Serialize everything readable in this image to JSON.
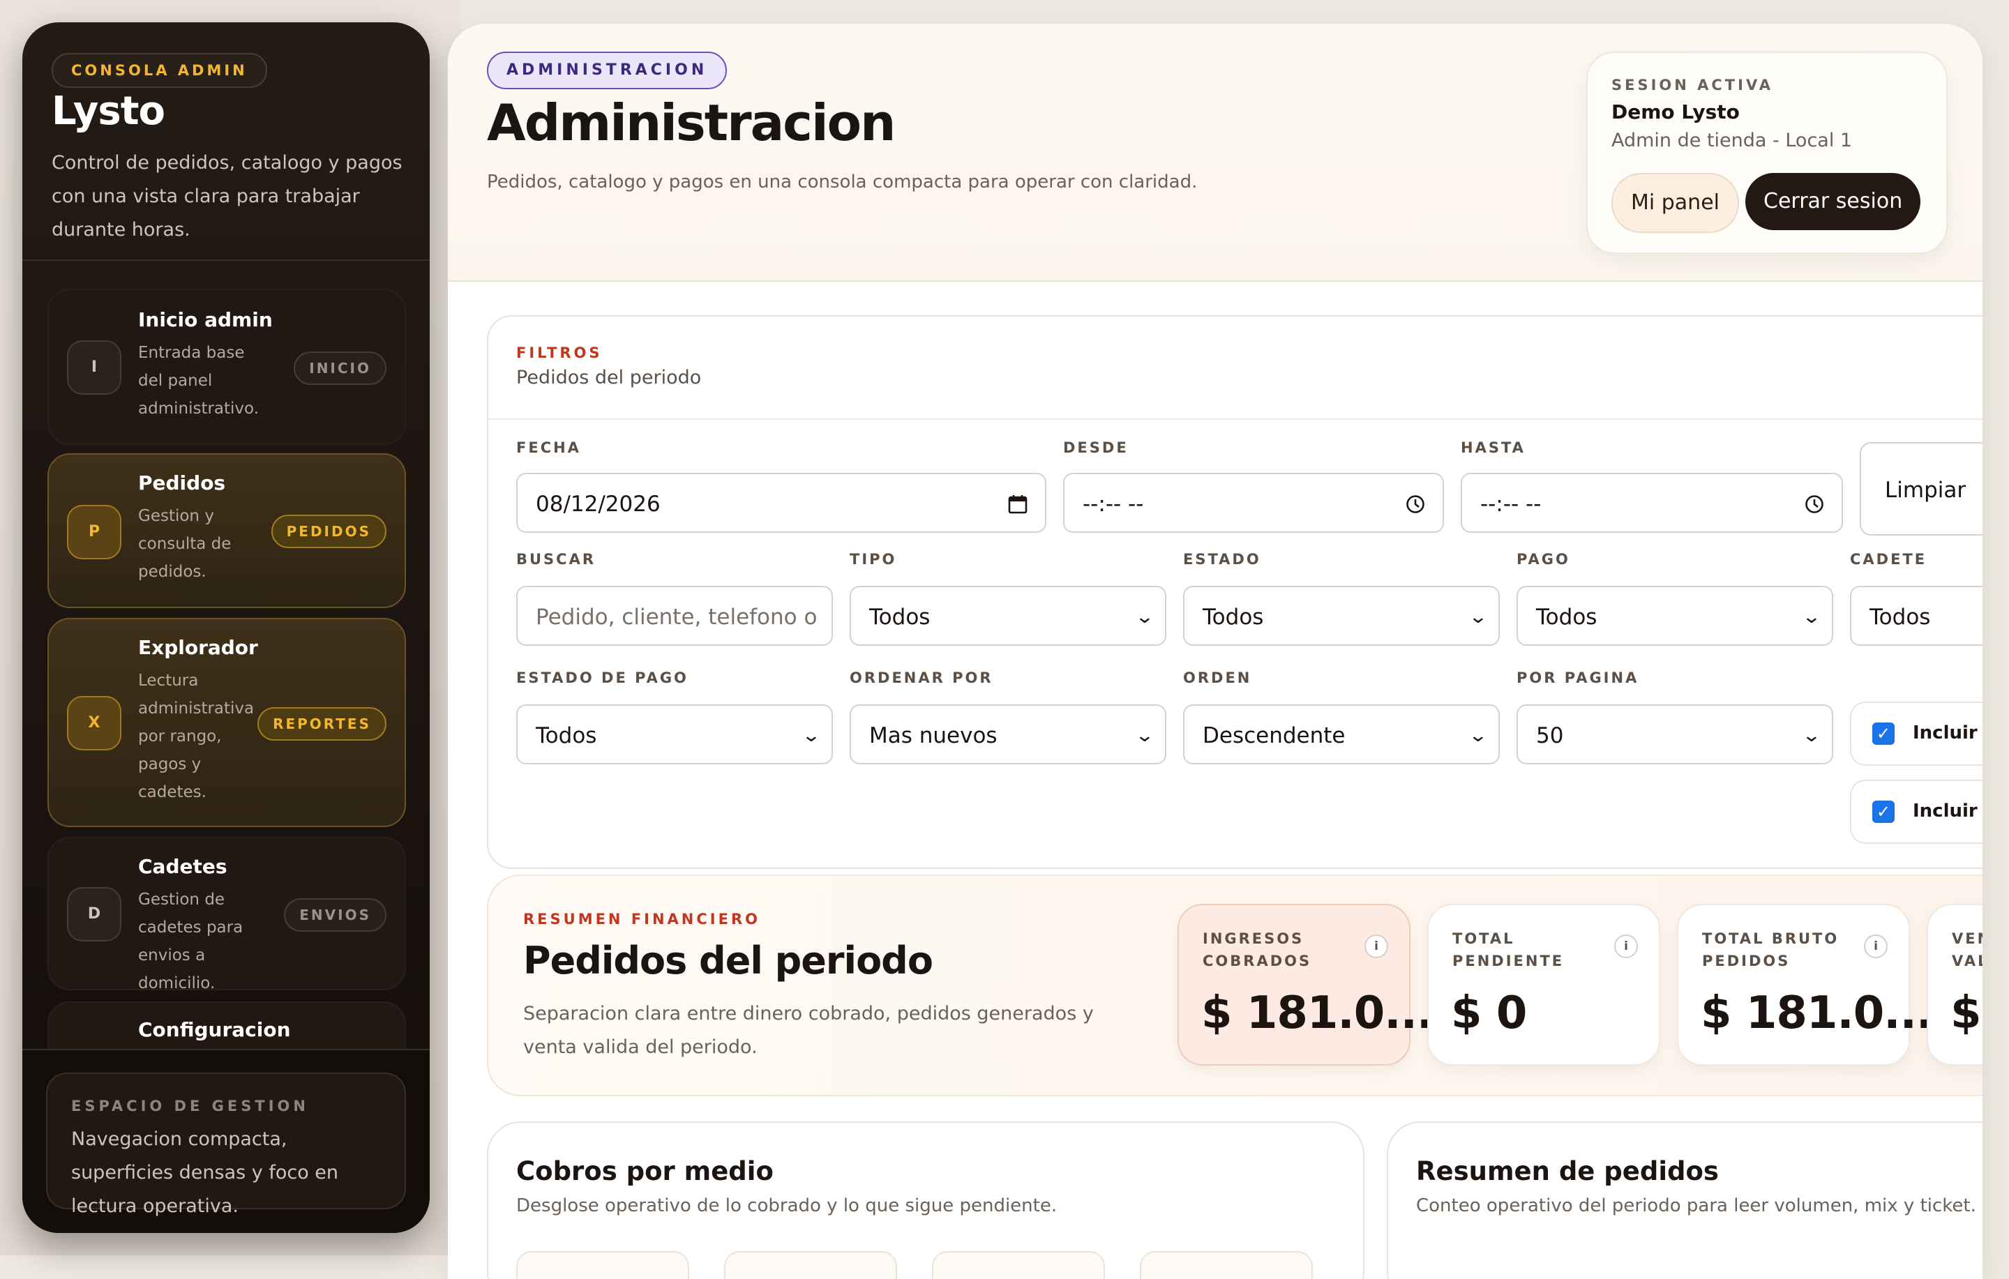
{
  "sidebar": {
    "kicker": "CONSOLA ADMIN",
    "brand": "Lysto",
    "description": "Control de pedidos, catalogo y pagos con una vista clara para trabajar durante horas.",
    "items": [
      {
        "letter": "I",
        "title": "Inicio admin",
        "desc": "Entrada base del panel administrativo.",
        "pill": "INICIO"
      },
      {
        "letter": "P",
        "title": "Pedidos",
        "desc": "Gestion y consulta de pedidos.",
        "pill": "PEDIDOS"
      },
      {
        "letter": "X",
        "title": "Explorador",
        "desc": "Lectura administrativa por rango, pagos y cadetes.",
        "pill": "REPORTES"
      },
      {
        "letter": "D",
        "title": "Cadetes",
        "desc": "Gestion de cadetes para envios a domicilio.",
        "pill": "ENVIOS"
      },
      {
        "title": "Configuracion"
      }
    ],
    "footer": {
      "kicker": "ESPACIO DE GESTION",
      "text": "Navegacion compacta, superficies densas y foco en lectura operativa."
    }
  },
  "header": {
    "chip": "ADMINISTRACION",
    "title": "Administracion",
    "subtitle": "Pedidos, catalogo y pagos en una consola compacta para operar con claridad.",
    "session": {
      "kicker": "SESION ACTIVA",
      "name": "Demo Lysto",
      "role": "Admin de tienda - Local 1",
      "panel_label": "Mi panel",
      "logout_label": "Cerrar sesion"
    }
  },
  "filters": {
    "kicker": "FILTROS",
    "subtitle": "Pedidos del periodo",
    "fecha": {
      "label": "FECHA",
      "value": "08/12/2026"
    },
    "desde": {
      "label": "DESDE",
      "value": "--:-- --"
    },
    "hasta": {
      "label": "HASTA",
      "value": "--:-- --"
    },
    "clear_label": "Limpiar",
    "buscar": {
      "label": "BUSCAR",
      "placeholder": "Pedido, cliente, telefono o"
    },
    "tipo": {
      "label": "TIPO",
      "value": "Todos"
    },
    "estado": {
      "label": "ESTADO",
      "value": "Todos"
    },
    "pago": {
      "label": "PAGO",
      "value": "Todos"
    },
    "cadete": {
      "label": "CADETE",
      "value": "Todos"
    },
    "estado_pago": {
      "label": "ESTADO DE PAGO",
      "value": "Todos"
    },
    "ordenar_por": {
      "label": "ORDENAR POR",
      "value": "Mas nuevos"
    },
    "orden": {
      "label": "ORDEN",
      "value": "Descendente"
    },
    "por_pagina": {
      "label": "POR PAGINA",
      "value": "50"
    },
    "check1": {
      "label": "Incluir ca",
      "checked": true
    },
    "check2": {
      "label": "Incluir p",
      "checked": true
    }
  },
  "resumen": {
    "kicker": "RESUMEN FINANCIERO",
    "title": "Pedidos del periodo",
    "description": "Separacion clara entre dinero cobrado, pedidos generados y venta valida del periodo.",
    "kpis": [
      {
        "label": "INGRESOS COBRADOS",
        "value": "$ 181.0..."
      },
      {
        "label": "TOTAL PENDIENTE",
        "value": "$ 0"
      },
      {
        "label": "TOTAL BRUTO PEDIDOS",
        "value": "$ 181.0..."
      },
      {
        "label": "VEN VAL",
        "value": "$"
      }
    ]
  },
  "cards": {
    "cobros": {
      "title": "Cobros por medio",
      "subtitle": "Desglose operativo de lo cobrado y lo que sigue pendiente."
    },
    "pedidos": {
      "title": "Resumen de pedidos",
      "subtitle": "Conteo operativo del periodo para leer volumen, mix y ticket."
    }
  }
}
